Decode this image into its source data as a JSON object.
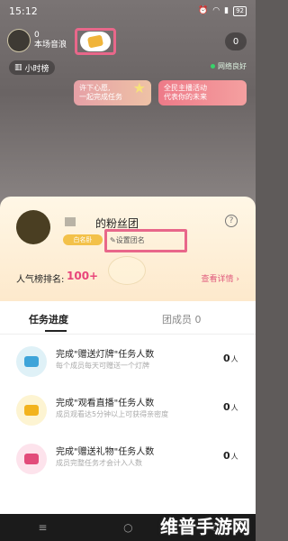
{
  "status": {
    "time": "15:12",
    "battery": "92"
  },
  "anchor": {
    "count": "0",
    "label": "本场音浪"
  },
  "viewer_count": "0",
  "rank_chip": "小时榜",
  "network": "网络良好",
  "promo1": {
    "line1": "许下心愿,",
    "line2": "一起完成任务"
  },
  "promo2": {
    "line1": "全民主播活动",
    "line2": "代表你的未来"
  },
  "club": {
    "title": "的粉丝团",
    "tag": "白名卧",
    "rename": "设置团名",
    "rank_label": "人气榜排名:",
    "rank_value": "100+",
    "detail": "查看详情 ›"
  },
  "tabs": {
    "progress": "任务进度",
    "members": "团成员 0"
  },
  "tasks": [
    {
      "title": "完成\"赠送灯牌\"任务人数",
      "desc": "每个成员每天可赠送一个灯牌",
      "count": "0",
      "unit": "人",
      "color": "#dff1f7",
      "glyph": "#3ea4d9"
    },
    {
      "title": "完成\"观看直播\"任务人数",
      "desc": "成员观看达5分钟以上可获得亲密度",
      "count": "0",
      "unit": "人",
      "color": "#fdf4d2",
      "glyph": "#f2b31e"
    },
    {
      "title": "完成\"赠送礼物\"任务人数",
      "desc": "成员完整任务才会计入人数",
      "count": "0",
      "unit": "人",
      "color": "#fde3ec",
      "glyph": "#e24b7a"
    }
  ],
  "nav": {
    "menu": "≡",
    "home": "○",
    "back": "◁"
  },
  "watermark": "维普手游网"
}
